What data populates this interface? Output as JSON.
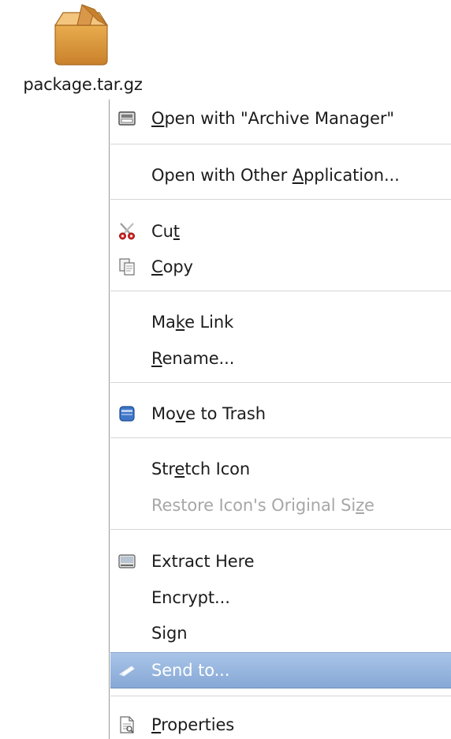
{
  "desktop": {
    "file": {
      "name": "package.tar.gz",
      "icon": "package-icon"
    }
  },
  "context_menu": {
    "highlight_color": "#97b5de",
    "items": [
      {
        "pre": "",
        "key": "O",
        "post": "pen with \"Archive Manager\"",
        "icon": "archive-manager-icon",
        "enabled": true,
        "highlighted": false
      },
      {
        "pre": "Open with Other ",
        "key": "A",
        "post": "pplication...",
        "icon": "",
        "enabled": true,
        "highlighted": false
      },
      {
        "pre": "Cu",
        "key": "t",
        "post": "",
        "icon": "scissors-icon",
        "enabled": true,
        "highlighted": false
      },
      {
        "pre": "",
        "key": "C",
        "post": "opy",
        "icon": "copy-icon",
        "enabled": true,
        "highlighted": false
      },
      {
        "pre": "Ma",
        "key": "k",
        "post": "e Link",
        "icon": "",
        "enabled": true,
        "highlighted": false
      },
      {
        "pre": "",
        "key": "R",
        "post": "ename...",
        "icon": "",
        "enabled": true,
        "highlighted": false
      },
      {
        "pre": "Mo",
        "key": "v",
        "post": "e to Trash",
        "icon": "trash-icon",
        "enabled": true,
        "highlighted": false
      },
      {
        "pre": "Str",
        "key": "e",
        "post": "tch Icon",
        "icon": "",
        "enabled": true,
        "highlighted": false
      },
      {
        "pre": "Restore Icon's Original Si",
        "key": "z",
        "post": "e",
        "icon": "",
        "enabled": false,
        "highlighted": false
      },
      {
        "pre": "Extract Here",
        "key": "",
        "post": "",
        "icon": "extract-icon",
        "enabled": true,
        "highlighted": false
      },
      {
        "pre": "Encrypt...",
        "key": "",
        "post": "",
        "icon": "",
        "enabled": true,
        "highlighted": false
      },
      {
        "pre": "Sign",
        "key": "",
        "post": "",
        "icon": "",
        "enabled": true,
        "highlighted": false
      },
      {
        "pre": "Send to...",
        "key": "",
        "post": "",
        "icon": "send-to-icon",
        "enabled": true,
        "highlighted": true
      },
      {
        "pre": "",
        "key": "P",
        "post": "roperties",
        "icon": "properties-icon",
        "enabled": true,
        "highlighted": false
      }
    ]
  }
}
